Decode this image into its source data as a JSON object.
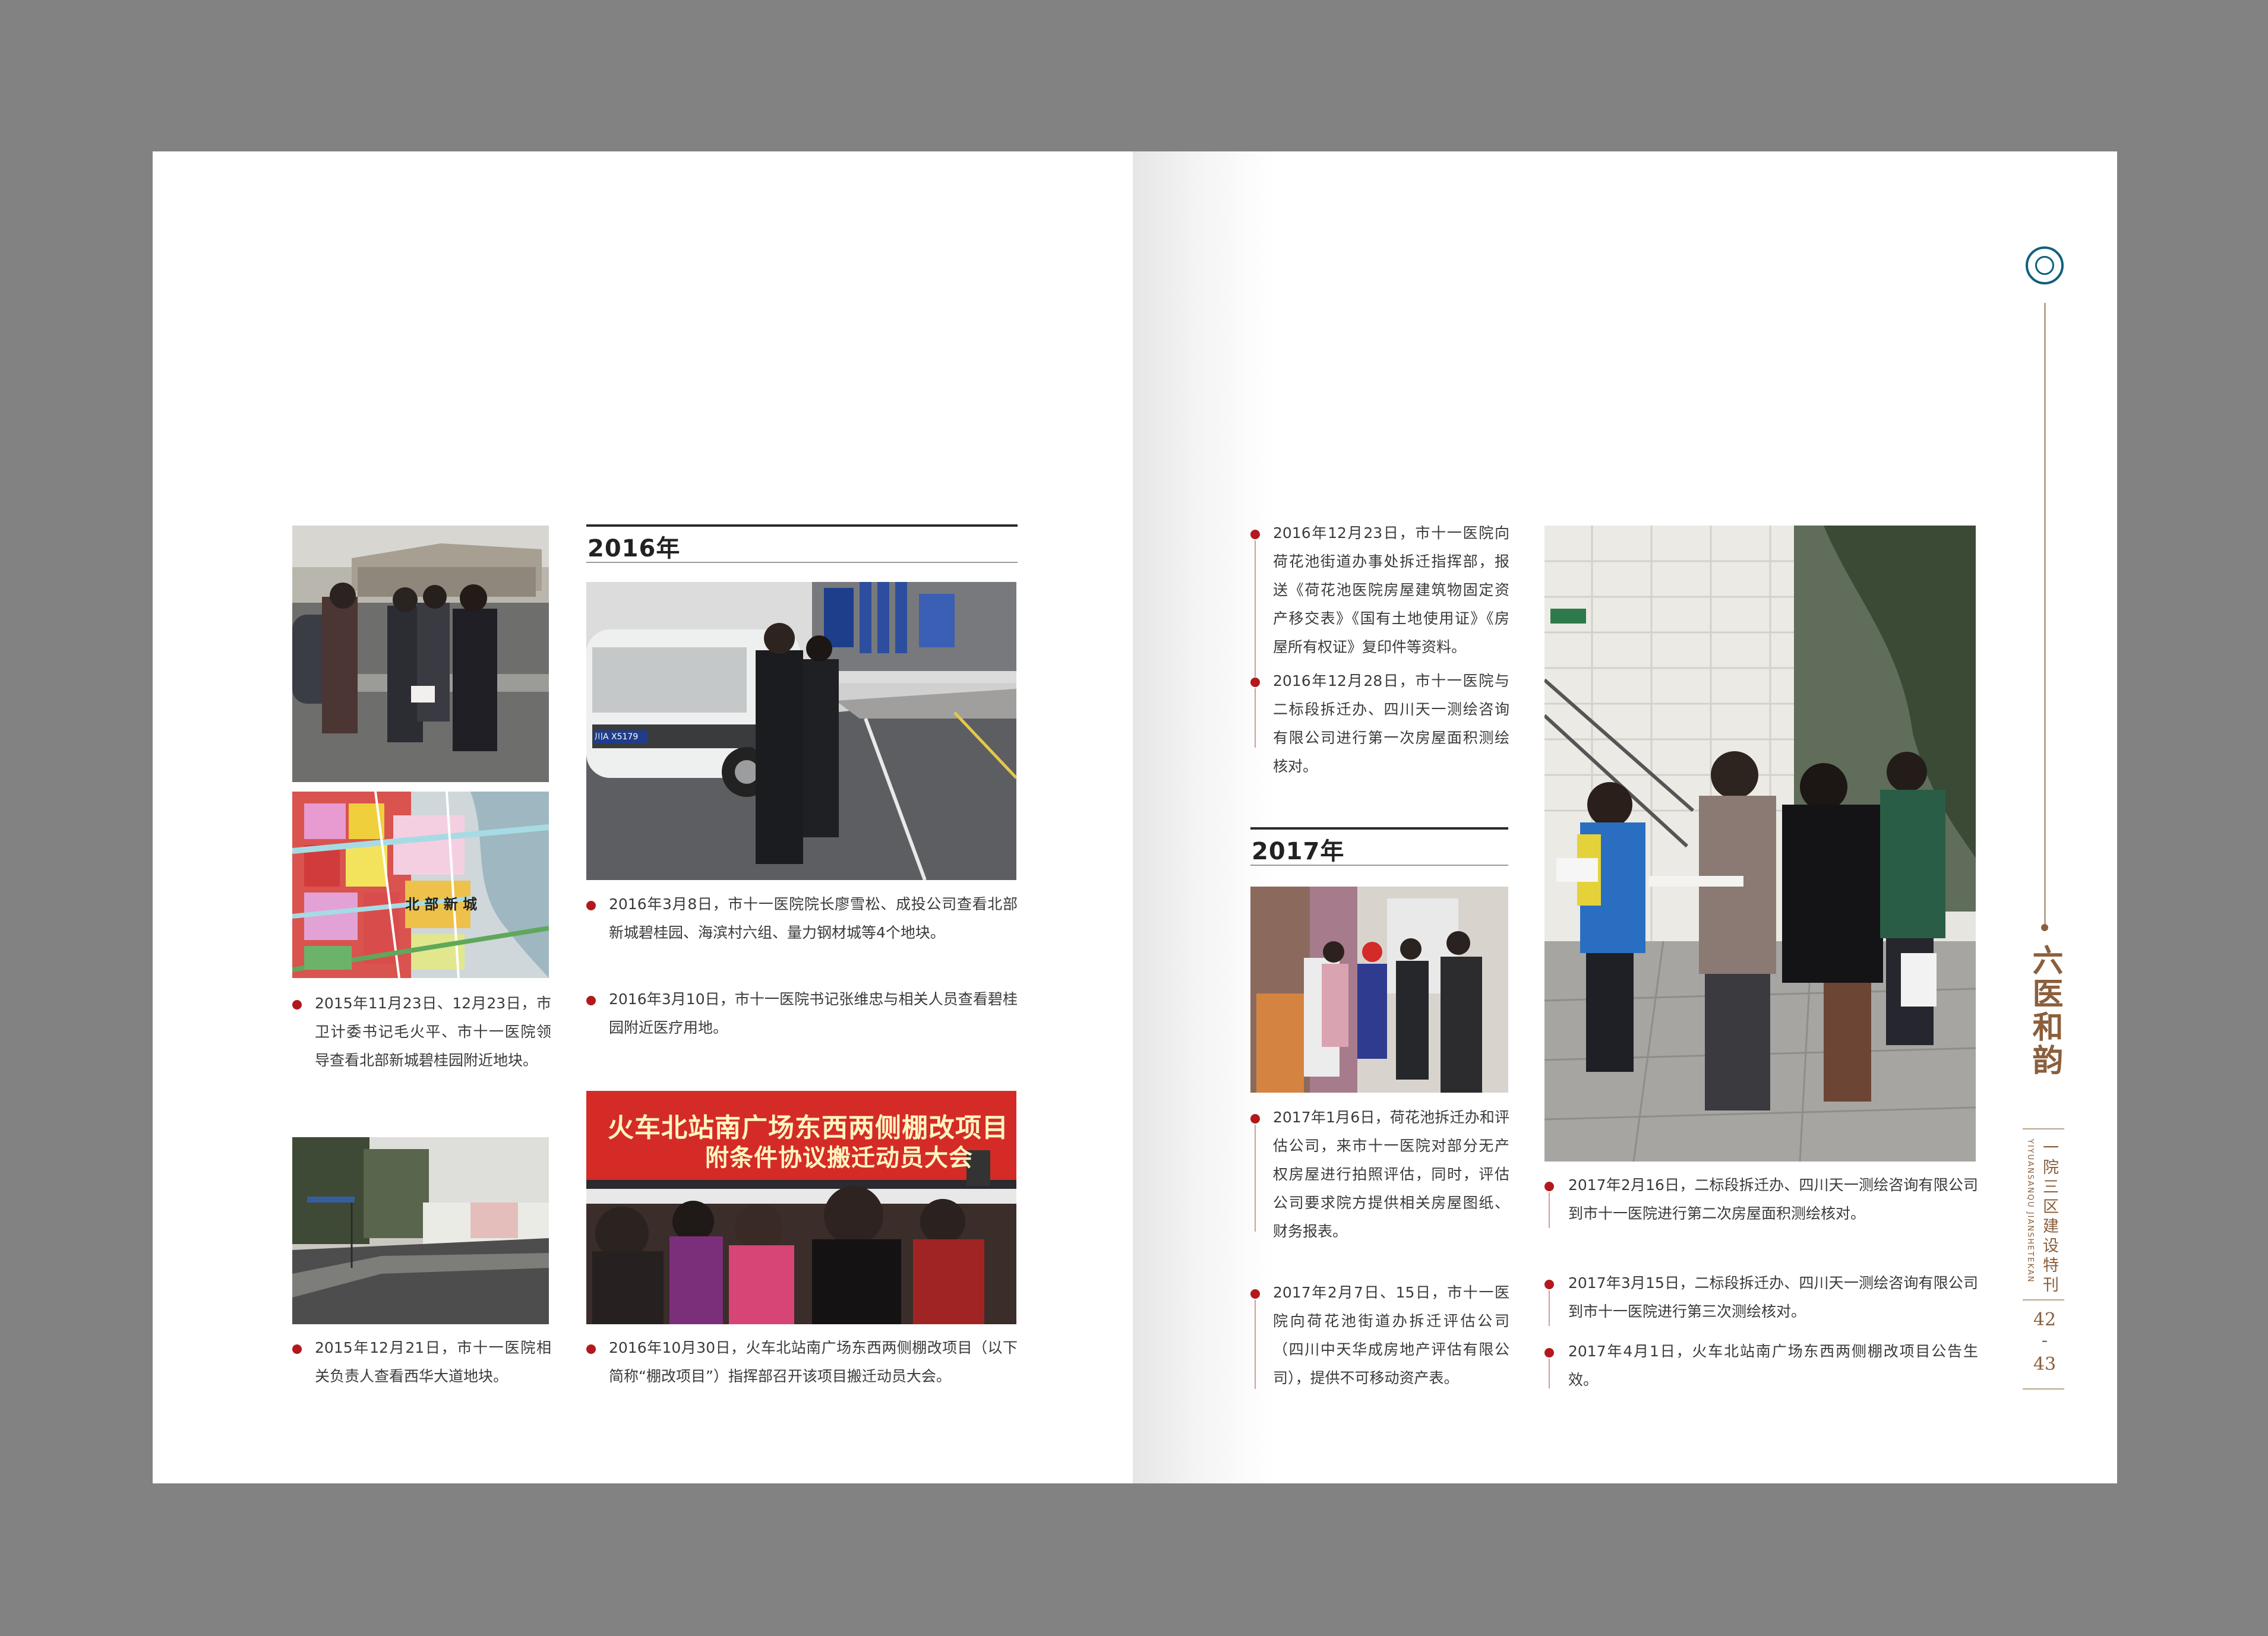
{
  "publication": {
    "title_vertical": "六医和韵",
    "subtitle_vertical": "一院三区建设特刊",
    "subtitle_pinyin": "YIYUANSANQU JIANSHETEKAN",
    "page_left": "42",
    "page_sep": "-",
    "page_right": "43"
  },
  "headings": {
    "y2016": "2016年",
    "y2017": "2017年"
  },
  "captions": {
    "c1": "2015年11月23日、12月23日，市卫计委书记毛火平、市十一医院领导查看北部新城碧桂园附近地块。",
    "c2": "2015年12月21日，市十一医院相关负责人查看西华大道地块。",
    "c3": "2016年3月8日，市十一医院院长廖雪松、成投公司查看北部新城碧桂园、海滨村六组、量力钢材城等4个地块。",
    "c4": "2016年3月10日，市十一医院书记张维忠与相关人员查看碧桂园附近医疗用地。",
    "c5": "2016年10月30日，火车北站南广场东西两侧棚改项目（以下简称“棚改项目”）指挥部召开该项目搬迁动员大会。",
    "c6": "2016年12月23日，市十一医院向荷花池街道办事处拆迁指挥部，报送《荷花池医院房屋建筑物固定资产移交表》《国有土地使用证》《房屋所有权证》复印件等资料。",
    "c7": "2016年12月28日，市十一医院与二标段拆迁办、四川天一测绘咨询有限公司进行第一次房屋面积测绘核对。",
    "c8": "2017年1月6日，荷花池拆迁办和评估公司，来市十一医院对部分无产权房屋进行拍照评估，同时，评估公司要求院方提供相关房屋图纸、财务报表。",
    "c9": "2017年2月7日、15日，市十一医院向荷花池街道办拆迁评估公司（四川中天华成房地产评估有限公司），提供不可移动资产表。",
    "c10": "2017年2月16日，二标段拆迁办、四川天一测绘咨询有限公司到市十一医院进行第二次房屋面积测绘核对。",
    "c11": "2017年3月15日，二标段拆迁办、四川天一测绘咨询有限公司到市十一医院进行第三次测绘核对。",
    "c12": "2017年4月1日，火车北站南广场东西两侧棚改项目公告生效。"
  },
  "photo_text": {
    "map_label": "北 部 新 城",
    "banner_line1": "火车北站南广场东西两侧棚改项目",
    "banner_line2": "附条件协议搬迁动员大会",
    "plate": "川A X5179"
  },
  "colors": {
    "bullet": "#b3191c",
    "accent_gold": "#8b5f3c",
    "seal_blue": "#0f5f7e"
  }
}
